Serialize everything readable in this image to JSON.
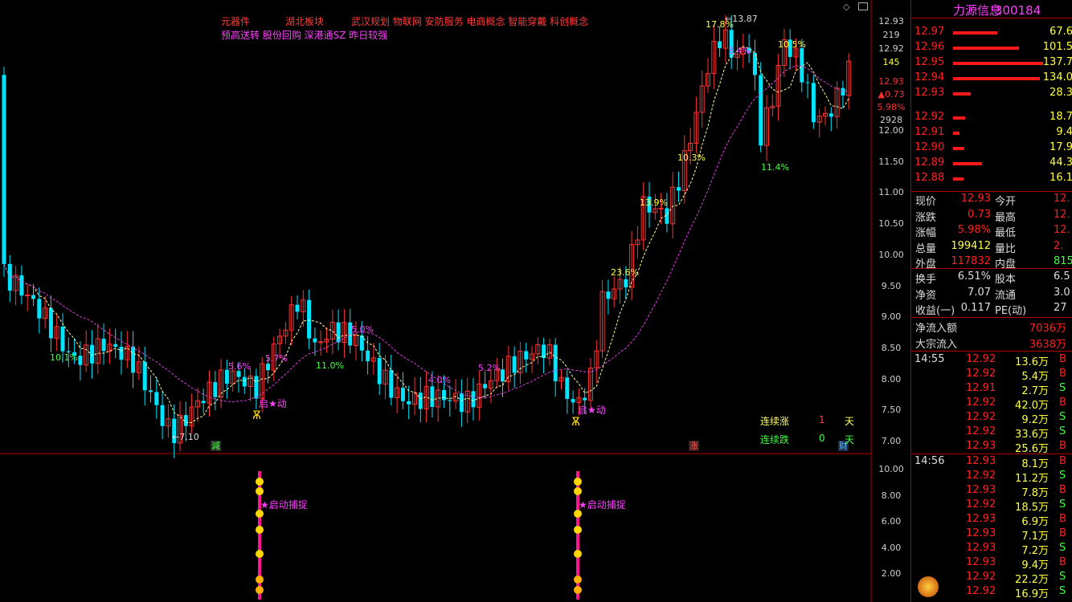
{
  "concepts": {
    "line1": [
      "元器件",
      "湖北板块",
      "武汉规划 物联网 安防服务 电商概念 智能穿戴 科创概念"
    ],
    "line2": "预高送转 股份回购 深港通SZ 昨日较强"
  },
  "annotations": {
    "high_label": "13.87",
    "low_label": "7.10",
    "pcts": [
      "10.1%",
      "5.6%",
      "5.7%",
      "11.0%",
      "5.0%",
      "4.0%",
      "5.2%",
      "23.6%",
      "13.9%",
      "10.3%",
      "17.8%",
      "3.4%",
      "11.4%",
      "10.5%"
    ],
    "start_signal": "启★动",
    "markers": {
      "reduce": "減",
      "rise": "涨",
      "fin": "财"
    }
  },
  "stats": {
    "up_label": "连续涨",
    "up_days": "1",
    "down_label": "连续跌",
    "down_days": "0",
    "unit": "天"
  },
  "y_axis": {
    "top_price": "12.93",
    "top_vol": "219",
    "second_price": "12.92",
    "second_vol": "145",
    "cur_price": "12.93",
    "cur_change": "▲0.73",
    "cur_pct": "5.98%",
    "cur_vol": "2928",
    "ticks": [
      "12.00",
      "11.50",
      "11.00",
      "10.50",
      "10.00",
      "9.50",
      "9.00",
      "8.50",
      "8.00",
      "7.50",
      "7.00"
    ]
  },
  "lower_panel": {
    "signal_text": "★启动捕捉",
    "ticks": [
      "10.00",
      "8.00",
      "6.00",
      "4.00",
      "2.00"
    ]
  },
  "stock": {
    "code": "300184",
    "name": "力源信息"
  },
  "orderbook": [
    {
      "price": "12.97",
      "vol": "67.6",
      "w": 55
    },
    {
      "price": "12.96",
      "vol": "101.5",
      "w": 82
    },
    {
      "price": "12.95",
      "vol": "137.7",
      "w": 112
    },
    {
      "price": "12.94",
      "vol": "134.0",
      "w": 108
    },
    {
      "price": "12.93",
      "vol": "28.3",
      "w": 22
    },
    {
      "price": "12.92",
      "vol": "18.7",
      "w": 15
    },
    {
      "price": "12.91",
      "vol": "9.4",
      "w": 8
    },
    {
      "price": "12.90",
      "vol": "17.9",
      "w": 14
    },
    {
      "price": "12.89",
      "vol": "44.3",
      "w": 36
    },
    {
      "price": "12.88",
      "vol": "16.1",
      "w": 13
    }
  ],
  "quote": [
    {
      "l": "现价",
      "v": "12.93",
      "vc": "#ff2020",
      "l2": "今开",
      "v2": "12.",
      "v2c": "#ff2020"
    },
    {
      "l": "涨跌",
      "v": "0.73",
      "vc": "#ff2020",
      "l2": "最高",
      "v2": "12.",
      "v2c": "#ff2020"
    },
    {
      "l": "涨幅",
      "v": "5.98%",
      "vc": "#ff2020",
      "l2": "最低",
      "v2": "12.",
      "v2c": "#ff2020"
    },
    {
      "l": "总量",
      "v": "199412",
      "vc": "#ffff40",
      "l2": "量比",
      "v2": "2.",
      "v2c": "#ff2020"
    },
    {
      "l": "外盘",
      "v": "117832",
      "vc": "#ff2020",
      "l2": "内盘",
      "v2": "815",
      "v2c": "#40ff40"
    }
  ],
  "quote2": [
    {
      "l": "换手",
      "v": "6.51%",
      "vc": "#ddd",
      "l2": "股本",
      "v2": "6.5",
      "v2c": "#ddd"
    },
    {
      "l": "净资",
      "v": "7.07",
      "vc": "#ddd",
      "l2": "流通",
      "v2": "3.0",
      "v2c": "#ddd"
    },
    {
      "l": "收益(一)",
      "v": "0.117",
      "vc": "#ddd",
      "l2": "PE(动)",
      "v2": "27",
      "v2c": "#ddd"
    }
  ],
  "flows": [
    {
      "l": "净流入额",
      "v": "7036万"
    },
    {
      "l": "大宗流入",
      "v": "3638万"
    }
  ],
  "ticks_block1": {
    "time": "14:55",
    "rows": [
      {
        "p": "12.92",
        "v": "13.6万",
        "bs": "B"
      },
      {
        "p": "12.92",
        "v": "5.4万",
        "bs": "B"
      },
      {
        "p": "12.91",
        "v": "2.7万",
        "bs": "S"
      },
      {
        "p": "12.92",
        "v": "42.0万",
        "bs": "B"
      },
      {
        "p": "12.92",
        "v": "9.2万",
        "bs": "S"
      },
      {
        "p": "12.92",
        "v": "33.6万",
        "bs": "S"
      },
      {
        "p": "12.93",
        "v": "25.6万",
        "bs": "B"
      }
    ]
  },
  "ticks_block2": {
    "time": "14:56",
    "rows": [
      {
        "p": "12.93",
        "v": "8.1万",
        "bs": "B"
      },
      {
        "p": "12.92",
        "v": "11.2万",
        "bs": "S"
      },
      {
        "p": "12.93",
        "v": "7.8万",
        "bs": "B"
      },
      {
        "p": "12.92",
        "v": "18.5万",
        "bs": "S"
      },
      {
        "p": "12.93",
        "v": "6.9万",
        "bs": "B"
      },
      {
        "p": "12.93",
        "v": "7.1万",
        "bs": "B"
      },
      {
        "p": "12.93",
        "v": "7.2万",
        "bs": "S"
      },
      {
        "p": "12.93",
        "v": "9.4万",
        "bs": "B"
      },
      {
        "p": "12.92",
        "v": "22.2万",
        "bs": "S"
      },
      {
        "p": "12.92",
        "v": "16.9万",
        "bs": "S"
      }
    ]
  },
  "colors": {
    "up": "#ff3333",
    "down": "#00e5ff",
    "ma_short": "#ffffa0",
    "ma_long": "#e040e0"
  }
}
